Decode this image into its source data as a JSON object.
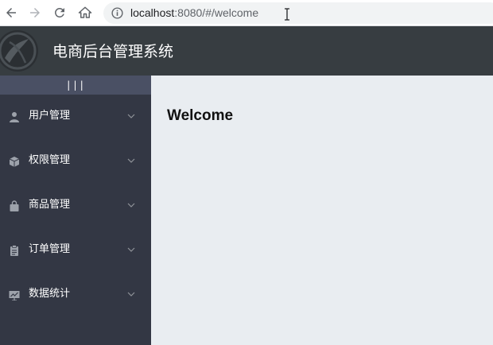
{
  "browser": {
    "back_icon": "arrow-left-icon",
    "forward_icon": "arrow-right-icon",
    "reload_icon": "reload-icon",
    "home_icon": "home-icon",
    "site_info_icon": "info-icon",
    "url_host": "localhost",
    "url_rest": ":8080/#/welcome"
  },
  "header": {
    "logo_icon": "logo-icon",
    "title": "电商后台管理系统",
    "background": "#373d41"
  },
  "sidebar": {
    "toggle_label": "|||",
    "background": "#333744",
    "toggle_background": "#4a5064",
    "items": [
      {
        "label": "用户管理",
        "icon": "user-icon"
      },
      {
        "label": "权限管理",
        "icon": "box-icon"
      },
      {
        "label": "商品管理",
        "icon": "bag-icon"
      },
      {
        "label": "订单管理",
        "icon": "clipboard-icon"
      },
      {
        "label": "数据统计",
        "icon": "chart-icon"
      }
    ]
  },
  "main": {
    "heading": "Welcome",
    "background": "#e9edf1"
  }
}
